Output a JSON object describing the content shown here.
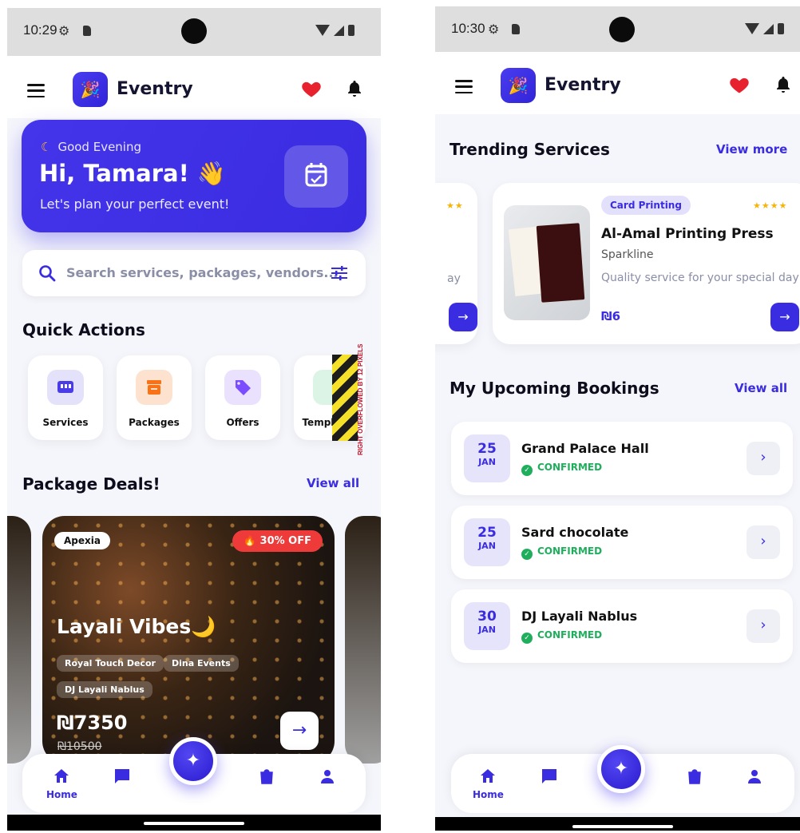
{
  "screen1": {
    "status": {
      "time": "10:29"
    },
    "appbar": {
      "brand": "Eventry"
    },
    "greeting": {
      "sub": "Good Evening",
      "hello": "Hi, Tamara! 👋",
      "tagline": "Let's plan your perfect event!"
    },
    "search": {
      "placeholder": "Search services, packages, vendors..."
    },
    "quick_actions": {
      "title": "Quick Actions",
      "items": [
        {
          "label": "Services",
          "icon": "storefront-icon",
          "color": "#4a3de8"
        },
        {
          "label": "Packages",
          "icon": "archive-box-icon",
          "color": "#f97316"
        },
        {
          "label": "Offers",
          "icon": "tag-icon",
          "color": "#7c4dff"
        },
        {
          "label": "Templates",
          "icon": "template-icon",
          "color": "#1aa35f"
        }
      ],
      "overflow_warning": "RIGHT OVERFLOWED BY 12 PIXELS"
    },
    "package_deals": {
      "title": "Package Deals!",
      "view_all": "View all",
      "deal": {
        "vendor": "Apexia",
        "discount": "🔥 30% OFF",
        "title": "Layali Vibes🌙",
        "tags": [
          "Royal Touch Decor",
          "Dina Events",
          "DJ Layali Nablus"
        ],
        "price": "₪7350",
        "old_price": "₪10500"
      }
    },
    "bottom_nav": {
      "home_label": "Home"
    }
  },
  "screen2": {
    "status": {
      "time": "10:30"
    },
    "appbar": {
      "brand": "Eventry"
    },
    "trending": {
      "title": "Trending Services",
      "view_more": "View more",
      "partial_card": {
        "suffix": "ay"
      },
      "card": {
        "category": "Card Printing",
        "name": "Al-Amal Printing Press",
        "vendor": "Sparkline",
        "description": "Quality service for your special day",
        "price": "₪6",
        "rating": 4
      }
    },
    "bookings": {
      "title": "My Upcoming Bookings",
      "view_all": "View all",
      "items": [
        {
          "day": "25",
          "month": "JAN",
          "name": "Grand Palace Hall",
          "status": "CONFIRMED"
        },
        {
          "day": "25",
          "month": "JAN",
          "name": "Sard chocolate",
          "status": "CONFIRMED"
        },
        {
          "day": "30",
          "month": "JAN",
          "name": "DJ Layali Nablus",
          "status": "CONFIRMED"
        }
      ]
    },
    "bottom_nav": {
      "home_label": "Home"
    }
  },
  "colors": {
    "accent": "#3a2ce0",
    "success": "#1fae5b",
    "danger": "#ef3a3a",
    "star": "#f5b40b"
  }
}
